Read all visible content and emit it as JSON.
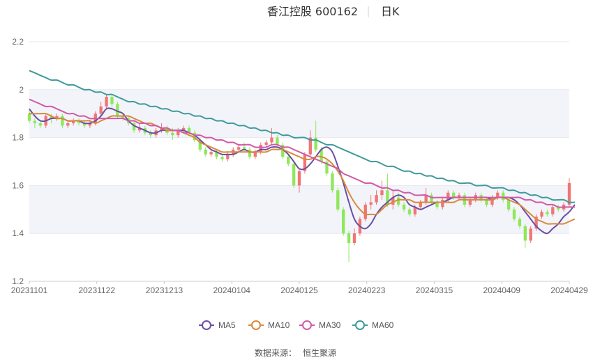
{
  "chart_data": {
    "type": "candlestick",
    "title": {
      "name": "香江控股 600162",
      "period": "日K"
    },
    "ylim": [
      1.2,
      2.2
    ],
    "y_ticks": [
      "1.2",
      "1.4",
      "1.6",
      "1.8",
      "2",
      "2.2"
    ],
    "x_ticks": [
      "20231101",
      "20231122",
      "20231213",
      "20240104",
      "20240125",
      "20240223",
      "20240315",
      "20240409",
      "20240429"
    ],
    "grid": true,
    "legend_position": "bottom",
    "colors": {
      "up": "#f07575",
      "down": "#8de85a",
      "MA5": "#6a4fa3",
      "MA10": "#d98a3c",
      "MA30": "#d05aa5",
      "MA60": "#3f9a9a",
      "band": "#f2f4fa",
      "grid": "#e6e8ee"
    },
    "candles": [
      [
        1.9,
        1.87,
        1.92,
        1.86
      ],
      [
        1.87,
        1.86,
        1.88,
        1.84
      ],
      [
        1.86,
        1.85,
        1.87,
        1.84
      ],
      [
        1.85,
        1.89,
        1.9,
        1.84
      ],
      [
        1.89,
        1.88,
        1.9,
        1.86
      ],
      [
        1.88,
        1.89,
        1.9,
        1.87
      ],
      [
        1.89,
        1.85,
        1.9,
        1.84
      ],
      [
        1.85,
        1.86,
        1.87,
        1.84
      ],
      [
        1.86,
        1.87,
        1.88,
        1.85
      ],
      [
        1.87,
        1.86,
        1.88,
        1.85
      ],
      [
        1.86,
        1.85,
        1.87,
        1.84
      ],
      [
        1.85,
        1.86,
        1.87,
        1.84
      ],
      [
        1.86,
        1.9,
        1.91,
        1.85
      ],
      [
        1.9,
        1.93,
        1.95,
        1.89
      ],
      [
        1.93,
        1.97,
        1.98,
        1.92
      ],
      [
        1.97,
        1.94,
        1.98,
        1.92
      ],
      [
        1.94,
        1.89,
        1.95,
        1.88
      ],
      [
        1.89,
        1.88,
        1.9,
        1.87
      ],
      [
        1.88,
        1.86,
        1.89,
        1.85
      ],
      [
        1.86,
        1.83,
        1.87,
        1.82
      ],
      [
        1.83,
        1.84,
        1.86,
        1.82
      ],
      [
        1.84,
        1.82,
        1.85,
        1.81
      ],
      [
        1.82,
        1.81,
        1.83,
        1.8
      ],
      [
        1.81,
        1.83,
        1.84,
        1.8
      ],
      [
        1.83,
        1.84,
        1.86,
        1.82
      ],
      [
        1.84,
        1.82,
        1.85,
        1.81
      ],
      [
        1.82,
        1.81,
        1.84,
        1.79
      ],
      [
        1.81,
        1.83,
        1.84,
        1.8
      ],
      [
        1.83,
        1.84,
        1.85,
        1.82
      ],
      [
        1.84,
        1.82,
        1.85,
        1.81
      ],
      [
        1.82,
        1.79,
        1.83,
        1.78
      ],
      [
        1.79,
        1.75,
        1.8,
        1.74
      ],
      [
        1.75,
        1.73,
        1.76,
        1.72
      ],
      [
        1.73,
        1.74,
        1.75,
        1.72
      ],
      [
        1.74,
        1.72,
        1.75,
        1.71
      ],
      [
        1.72,
        1.71,
        1.73,
        1.7
      ],
      [
        1.71,
        1.73,
        1.74,
        1.7
      ],
      [
        1.73,
        1.75,
        1.76,
        1.72
      ],
      [
        1.75,
        1.76,
        1.77,
        1.74
      ],
      [
        1.76,
        1.75,
        1.78,
        1.74
      ],
      [
        1.75,
        1.72,
        1.76,
        1.71
      ],
      [
        1.72,
        1.74,
        1.75,
        1.71
      ],
      [
        1.74,
        1.77,
        1.78,
        1.73
      ],
      [
        1.77,
        1.78,
        1.79,
        1.76
      ],
      [
        1.78,
        1.8,
        1.84,
        1.77
      ],
      [
        1.8,
        1.77,
        1.81,
        1.76
      ],
      [
        1.77,
        1.72,
        1.78,
        1.71
      ],
      [
        1.72,
        1.69,
        1.73,
        1.68
      ],
      [
        1.69,
        1.6,
        1.7,
        1.59
      ],
      [
        1.6,
        1.66,
        1.67,
        1.57
      ],
      [
        1.66,
        1.73,
        1.74,
        1.65
      ],
      [
        1.73,
        1.8,
        1.83,
        1.72
      ],
      [
        1.8,
        1.75,
        1.87,
        1.74
      ],
      [
        1.75,
        1.7,
        1.76,
        1.69
      ],
      [
        1.7,
        1.65,
        1.71,
        1.64
      ],
      [
        1.65,
        1.58,
        1.66,
        1.57
      ],
      [
        1.58,
        1.5,
        1.59,
        1.49
      ],
      [
        1.5,
        1.4,
        1.51,
        1.39
      ],
      [
        1.4,
        1.36,
        1.41,
        1.28
      ],
      [
        1.36,
        1.4,
        1.42,
        1.35
      ],
      [
        1.4,
        1.46,
        1.47,
        1.39
      ],
      [
        1.46,
        1.52,
        1.53,
        1.45
      ],
      [
        1.52,
        1.53,
        1.56,
        1.5
      ],
      [
        1.53,
        1.56,
        1.58,
        1.52
      ],
      [
        1.56,
        1.58,
        1.62,
        1.54
      ],
      [
        1.58,
        1.52,
        1.65,
        1.51
      ],
      [
        1.52,
        1.55,
        1.58,
        1.5
      ],
      [
        1.55,
        1.52,
        1.57,
        1.51
      ],
      [
        1.52,
        1.5,
        1.53,
        1.49
      ],
      [
        1.5,
        1.48,
        1.51,
        1.47
      ],
      [
        1.48,
        1.51,
        1.52,
        1.47
      ],
      [
        1.51,
        1.53,
        1.54,
        1.5
      ],
      [
        1.53,
        1.56,
        1.59,
        1.52
      ],
      [
        1.56,
        1.53,
        1.57,
        1.52
      ],
      [
        1.53,
        1.51,
        1.54,
        1.5
      ],
      [
        1.51,
        1.54,
        1.55,
        1.5
      ],
      [
        1.54,
        1.57,
        1.58,
        1.53
      ],
      [
        1.57,
        1.55,
        1.58,
        1.54
      ],
      [
        1.55,
        1.56,
        1.57,
        1.54
      ],
      [
        1.56,
        1.52,
        1.57,
        1.51
      ],
      [
        1.52,
        1.54,
        1.55,
        1.51
      ],
      [
        1.54,
        1.56,
        1.57,
        1.53
      ],
      [
        1.56,
        1.54,
        1.57,
        1.53
      ],
      [
        1.54,
        1.52,
        1.55,
        1.51
      ],
      [
        1.52,
        1.55,
        1.56,
        1.51
      ],
      [
        1.55,
        1.57,
        1.58,
        1.54
      ],
      [
        1.57,
        1.54,
        1.58,
        1.53
      ],
      [
        1.54,
        1.5,
        1.55,
        1.49
      ],
      [
        1.5,
        1.46,
        1.51,
        1.45
      ],
      [
        1.46,
        1.43,
        1.47,
        1.42
      ],
      [
        1.43,
        1.37,
        1.44,
        1.34
      ],
      [
        1.37,
        1.42,
        1.43,
        1.36
      ],
      [
        1.42,
        1.47,
        1.48,
        1.41
      ],
      [
        1.47,
        1.49,
        1.5,
        1.46
      ],
      [
        1.49,
        1.48,
        1.5,
        1.47
      ],
      [
        1.48,
        1.51,
        1.52,
        1.47
      ],
      [
        1.51,
        1.5,
        1.52,
        1.49
      ],
      [
        1.5,
        1.52,
        1.53,
        1.49
      ],
      [
        1.52,
        1.61,
        1.63,
        1.51
      ]
    ],
    "series": [
      {
        "name": "MA5",
        "values": [
          1.92,
          1.89,
          1.87,
          1.87,
          1.88,
          1.88,
          1.88,
          1.87,
          1.87,
          1.87,
          1.86,
          1.86,
          1.87,
          1.89,
          1.92,
          1.92,
          1.91,
          1.9,
          1.87,
          1.85,
          1.84,
          1.83,
          1.82,
          1.82,
          1.83,
          1.83,
          1.83,
          1.83,
          1.83,
          1.82,
          1.81,
          1.79,
          1.77,
          1.75,
          1.74,
          1.73,
          1.73,
          1.73,
          1.74,
          1.75,
          1.74,
          1.74,
          1.75,
          1.75,
          1.76,
          1.76,
          1.75,
          1.73,
          1.7,
          1.67,
          1.67,
          1.69,
          1.72,
          1.75,
          1.76,
          1.74,
          1.68,
          1.61,
          1.53,
          1.46,
          1.43,
          1.42,
          1.44,
          1.48,
          1.51,
          1.53,
          1.55,
          1.56,
          1.55,
          1.52,
          1.51,
          1.5,
          1.51,
          1.52,
          1.53,
          1.53,
          1.54,
          1.55,
          1.55,
          1.55,
          1.55,
          1.55,
          1.55,
          1.55,
          1.54,
          1.55,
          1.55,
          1.55,
          1.54,
          1.52,
          1.49,
          1.46,
          1.43,
          1.41,
          1.4,
          1.42,
          1.44,
          1.47,
          1.49,
          1.52
        ]
      },
      {
        "name": "MA10",
        "values": [
          1.9,
          1.9,
          1.9,
          1.9,
          1.89,
          1.88,
          1.88,
          1.87,
          1.87,
          1.87,
          1.87,
          1.87,
          1.86,
          1.87,
          1.88,
          1.89,
          1.89,
          1.89,
          1.89,
          1.88,
          1.87,
          1.86,
          1.86,
          1.85,
          1.84,
          1.83,
          1.83,
          1.83,
          1.82,
          1.81,
          1.8,
          1.78,
          1.77,
          1.76,
          1.75,
          1.74,
          1.74,
          1.74,
          1.74,
          1.74,
          1.74,
          1.74,
          1.74,
          1.74,
          1.75,
          1.75,
          1.75,
          1.74,
          1.73,
          1.72,
          1.71,
          1.71,
          1.72,
          1.72,
          1.71,
          1.69,
          1.66,
          1.62,
          1.57,
          1.53,
          1.5,
          1.48,
          1.48,
          1.48,
          1.5,
          1.52,
          1.53,
          1.54,
          1.54,
          1.54,
          1.53,
          1.53,
          1.53,
          1.53,
          1.53,
          1.53,
          1.53,
          1.53,
          1.54,
          1.54,
          1.54,
          1.54,
          1.54,
          1.54,
          1.54,
          1.55,
          1.55,
          1.54,
          1.53,
          1.52,
          1.5,
          1.48,
          1.46,
          1.45,
          1.44,
          1.44,
          1.44,
          1.44,
          1.45,
          1.46
        ]
      },
      {
        "name": "MA30",
        "values": [
          1.96,
          1.95,
          1.94,
          1.93,
          1.93,
          1.92,
          1.91,
          1.9,
          1.9,
          1.89,
          1.89,
          1.88,
          1.88,
          1.88,
          1.88,
          1.88,
          1.88,
          1.88,
          1.87,
          1.87,
          1.86,
          1.86,
          1.85,
          1.85,
          1.84,
          1.84,
          1.83,
          1.83,
          1.82,
          1.82,
          1.81,
          1.81,
          1.8,
          1.8,
          1.79,
          1.79,
          1.78,
          1.78,
          1.77,
          1.77,
          1.77,
          1.76,
          1.76,
          1.76,
          1.77,
          1.77,
          1.76,
          1.76,
          1.75,
          1.74,
          1.73,
          1.72,
          1.71,
          1.7,
          1.69,
          1.68,
          1.67,
          1.65,
          1.64,
          1.63,
          1.62,
          1.61,
          1.61,
          1.6,
          1.59,
          1.59,
          1.58,
          1.58,
          1.57,
          1.57,
          1.56,
          1.56,
          1.56,
          1.55,
          1.55,
          1.55,
          1.55,
          1.55,
          1.55,
          1.55,
          1.55,
          1.55,
          1.55,
          1.55,
          1.55,
          1.55,
          1.55,
          1.55,
          1.55,
          1.55,
          1.54,
          1.54,
          1.53,
          1.53,
          1.52,
          1.52,
          1.51,
          1.51,
          1.51,
          1.51
        ]
      },
      {
        "name": "MA60",
        "values": [
          2.08,
          2.07,
          2.06,
          2.05,
          2.04,
          2.04,
          2.03,
          2.02,
          2.02,
          2.01,
          2.0,
          2.0,
          1.99,
          1.99,
          1.98,
          1.98,
          1.97,
          1.96,
          1.95,
          1.95,
          1.94,
          1.94,
          1.93,
          1.93,
          1.92,
          1.92,
          1.91,
          1.91,
          1.9,
          1.9,
          1.89,
          1.89,
          1.88,
          1.88,
          1.87,
          1.87,
          1.86,
          1.86,
          1.85,
          1.85,
          1.84,
          1.84,
          1.83,
          1.83,
          1.82,
          1.82,
          1.81,
          1.81,
          1.8,
          1.8,
          1.8,
          1.79,
          1.79,
          1.78,
          1.77,
          1.77,
          1.76,
          1.75,
          1.74,
          1.73,
          1.72,
          1.71,
          1.7,
          1.7,
          1.69,
          1.68,
          1.68,
          1.67,
          1.66,
          1.66,
          1.65,
          1.65,
          1.64,
          1.64,
          1.63,
          1.63,
          1.62,
          1.62,
          1.61,
          1.61,
          1.61,
          1.6,
          1.6,
          1.6,
          1.59,
          1.59,
          1.59,
          1.58,
          1.58,
          1.57,
          1.57,
          1.56,
          1.56,
          1.55,
          1.55,
          1.54,
          1.54,
          1.54,
          1.53,
          1.53
        ]
      }
    ],
    "source": {
      "label": "数据来源：",
      "value": "恒生聚源"
    }
  }
}
